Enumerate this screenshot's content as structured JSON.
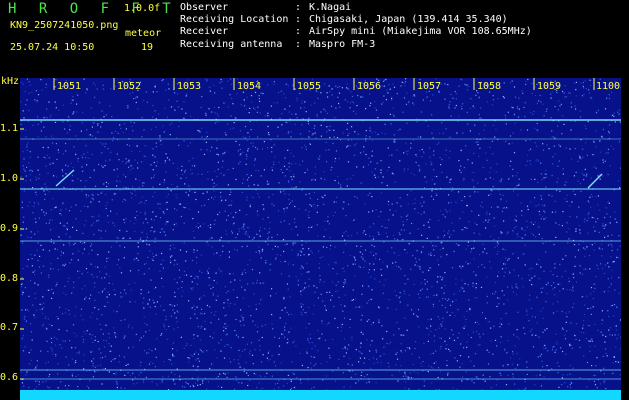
{
  "header": {
    "brand": "H R O F F T",
    "version": "1.0.0f",
    "filename": "KN9_2507241050.png",
    "tag": "meteor",
    "datetime": "25.07.24 10:50",
    "count": "19"
  },
  "meta": [
    {
      "key": "Observer",
      "value": "K.Nagai"
    },
    {
      "key": "Receiving Location",
      "value": "Chigasaki, Japan (139.414 35.340)"
    },
    {
      "key": "Receiver",
      "value": "AirSpy mini (Miakejima VOR 108.65MHz)"
    },
    {
      "key": "Receiving antenna",
      "value": "Maspro FM-3"
    }
  ],
  "sep": ":",
  "spectrogram": {
    "unit": "kHz",
    "y_ticks": [
      "1.1",
      "1.0",
      "0.9",
      "0.8",
      "0.7",
      "0.6"
    ],
    "x_ticks": [
      "1051",
      "1052",
      "1053",
      "1054",
      "1055",
      "1056",
      "1057",
      "1058",
      "1059",
      "1100"
    ],
    "background": "#07128a",
    "signal_color": "#7fe6ff",
    "tick_color": "#ffff40"
  }
}
